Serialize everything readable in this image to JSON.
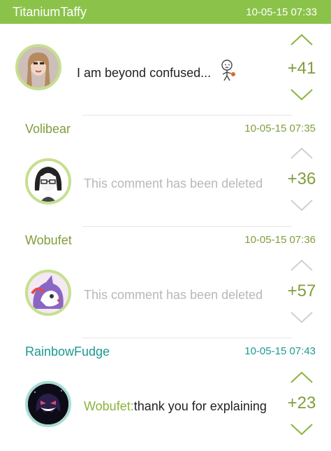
{
  "thread": {
    "top_user": "TitaniumTaffy",
    "top_time": "10-05-15 07:33"
  },
  "comments": [
    {
      "username": "",
      "timestamp": "",
      "text": "I am beyond confused...",
      "score": "+41",
      "avatar_icon": "avatar-photo",
      "deleted": false
    },
    {
      "username": "Volibear",
      "timestamp": "10-05-15 07:35",
      "text": "This comment has been deleted",
      "score": "+36",
      "avatar_icon": "avatar-anime",
      "deleted": true
    },
    {
      "username": "Wobufet",
      "timestamp": "10-05-15 07:36",
      "text": "This comment has been deleted",
      "score": "+57",
      "avatar_icon": "avatar-pokemon",
      "deleted": true
    },
    {
      "username": "RainbowFudge",
      "timestamp": "10-05-15 07:43",
      "reply_to": "Wobufet:",
      "text": "thank you for explaining",
      "score": "+23",
      "avatar_icon": "avatar-ghost",
      "deleted": false
    }
  ],
  "colors": {
    "accent": "#8bc34a",
    "username_green": "#7f9e3c",
    "username_teal": "#1b9a8f",
    "deleted_text": "#b8b8b8",
    "arrow_active": "#8cb33a",
    "arrow_inactive": "#d0d0d0"
  }
}
